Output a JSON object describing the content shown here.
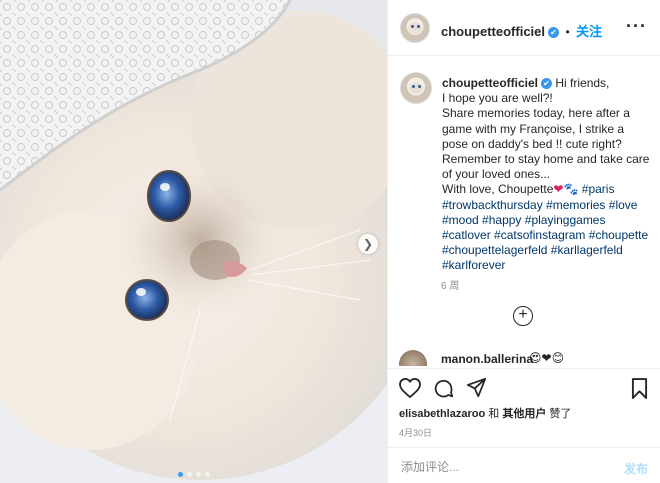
{
  "post": {
    "author": "choupetteofficiel",
    "verified_mark": "✔",
    "separator": "•",
    "follow_label": "关注",
    "caption": {
      "greeting": "Hi friends,",
      "line1": "I hope you are well?!",
      "line2": "Share memories today, here after a game with my Françoise, I strike a pose on daddy's bed !! cute right?",
      "line3": "Remember to stay home and take care of your loved ones...",
      "signoff": "With love, Choupette",
      "emoji_heart": "❤",
      "emoji_paw": "🐾",
      "hashtags": [
        "#paris",
        "#trowbackthursday",
        "#memories",
        "#love",
        "#mood",
        "#happy",
        "#playinggames",
        "#catlover",
        "#catsofinstagram",
        "#choupette",
        "#choupettelagerfeld",
        "#karllagerfeld",
        "#karlforever"
      ]
    },
    "time_ago": "6 周",
    "comment": {
      "user": "manon.ballerina",
      "emojis": "😍❤😊"
    },
    "likes": {
      "user": "elisabethlazaroo",
      "and": "和",
      "others": "其他用户",
      "liked": "赞了"
    },
    "date": "4月30日",
    "comment_placeholder": "添加评论...",
    "post_label": "发布",
    "carousel": {
      "count": 4,
      "active_index": 0
    }
  },
  "icons": {
    "next": "chevron-right-icon",
    "more": "more-options-icon",
    "add": "plus-circle-icon",
    "like": "heart-icon",
    "comment": "comment-icon",
    "share": "share-icon",
    "save": "bookmark-icon"
  },
  "colors": {
    "link": "#00376b",
    "follow": "#0095f6",
    "verified": "#3897f0",
    "muted": "#8e8e8e"
  }
}
